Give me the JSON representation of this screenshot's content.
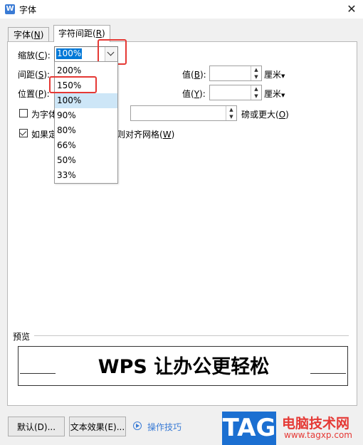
{
  "window": {
    "title": "字体",
    "app_icon_letter": "W",
    "close_glyph": "✕"
  },
  "tabs": [
    {
      "label": "字体",
      "hotkey": "N"
    },
    {
      "label": "字符间距",
      "hotkey": "R",
      "active": true
    }
  ],
  "scale": {
    "label": "缩放",
    "hotkey": "C",
    "value": "100%",
    "options": [
      "200%",
      "150%",
      "100%",
      "90%",
      "80%",
      "66%",
      "50%",
      "33%"
    ],
    "hovered_option": "100%",
    "highlighted_option": "150%"
  },
  "spacing": {
    "label": "间距",
    "hotkey": "S",
    "value_label": "值",
    "value_hotkey": "B",
    "unit": "厘米"
  },
  "position": {
    "label": "位置",
    "hotkey": "P",
    "value_label": "值",
    "value_hotkey": "Y",
    "unit": "厘米"
  },
  "kerning": {
    "label_visible": "为字体",
    "suffix": "磅或更大",
    "hotkey": "O",
    "checked": false
  },
  "grid_align": {
    "label_visible": "如果定",
    "suffix": "则对齐网格",
    "hotkey": "W",
    "checked": true
  },
  "preview": {
    "label": "预览",
    "sample_text": "WPS 让办公更轻松"
  },
  "buttons": {
    "default": "默认(D)...",
    "text_effect": "文本效果(E)...",
    "tips": "操作技巧"
  },
  "watermark": {
    "badge": "TAG",
    "title": "电脑技术网",
    "url": "www.tagxp.com"
  },
  "colors": {
    "accent": "#0078d7",
    "highlight_box": "#e53935",
    "link": "#3a7bd5",
    "watermark_blue": "#1b6fd1"
  }
}
